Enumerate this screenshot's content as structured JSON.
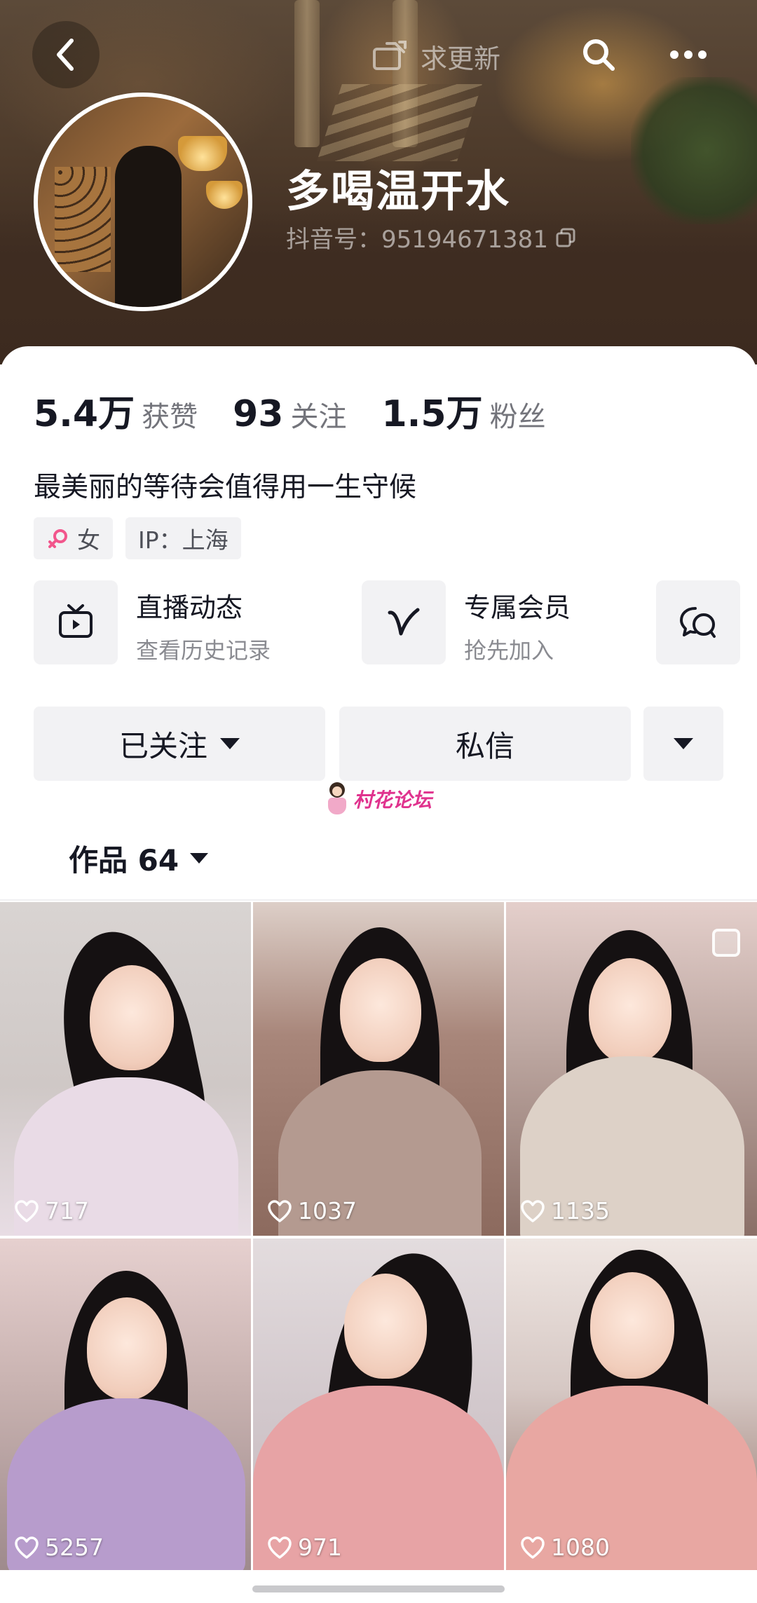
{
  "header": {
    "update_label": "求更新",
    "nickname": "多喝温开水",
    "douyin_id": "抖音号：95194671381"
  },
  "stats": [
    {
      "value": "5.4万",
      "label": "获赞"
    },
    {
      "value": "93",
      "label": "关注"
    },
    {
      "value": "1.5万",
      "label": "粉丝"
    }
  ],
  "bio": "最美丽的等待会值得用一生守候",
  "tags": {
    "gender": "女",
    "ip": "IP：上海"
  },
  "features": [
    {
      "title": "直播动态",
      "subtitle": "查看历史记录",
      "icon": "tv-icon"
    },
    {
      "title": "专属会员",
      "subtitle": "抢先加入",
      "icon": "v-membership-icon"
    },
    {
      "icon": "group-chat-icon"
    }
  ],
  "actions": {
    "follow_label": "已关注",
    "message_label": "私信"
  },
  "watermark": "村花论坛",
  "works_tab": {
    "label": "作品 64"
  },
  "videos": [
    {
      "likes": "717"
    },
    {
      "likes": "1037"
    },
    {
      "likes": "1135"
    },
    {
      "likes": "5257"
    },
    {
      "likes": "971"
    },
    {
      "likes": "1080"
    }
  ],
  "colors": {
    "accent_pink": "#e0338e",
    "gender_pink": "#f2568c",
    "text_primary": "#161823",
    "button_bg": "#f2f2f4"
  }
}
